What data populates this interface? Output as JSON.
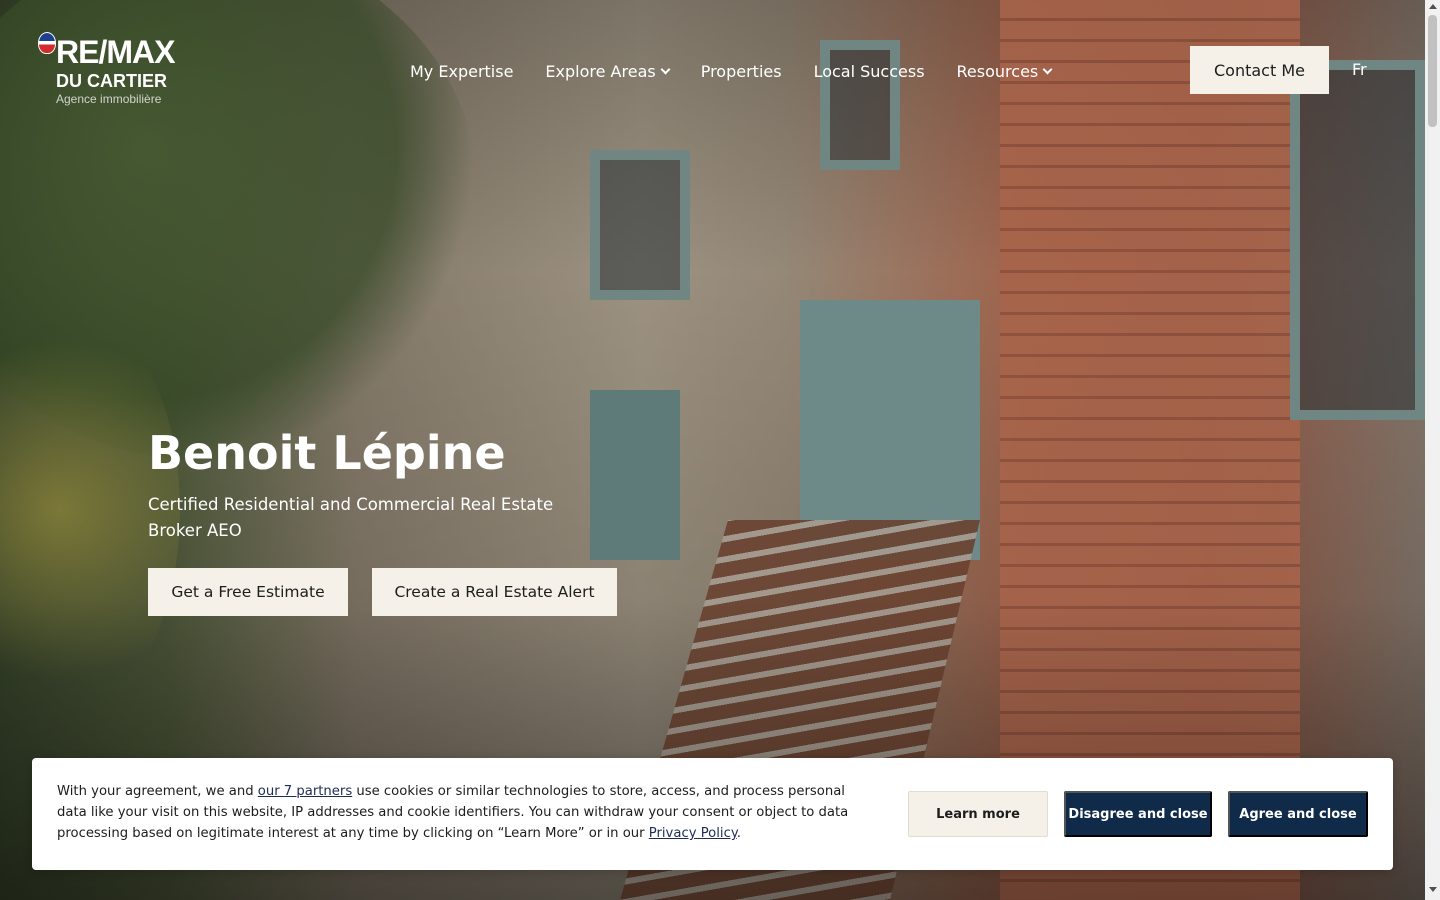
{
  "brand": {
    "name": "RE/MAX",
    "office": "DU CARTIER",
    "agency": "Agence immobilière"
  },
  "nav": {
    "items": [
      {
        "label": "My Expertise",
        "dropdown": false
      },
      {
        "label": "Explore Areas",
        "dropdown": true
      },
      {
        "label": "Properties",
        "dropdown": false
      },
      {
        "label": "Local Success",
        "dropdown": false
      },
      {
        "label": "Resources",
        "dropdown": true
      }
    ],
    "contact_label": "Contact Me",
    "language_label": "Fr"
  },
  "hero": {
    "name": "Benoit Lépine",
    "title": "Certified Residential and Commercial Real Estate Broker AEO",
    "cta_estimate": "Get a Free Estimate",
    "cta_alert": "Create a Real Estate Alert"
  },
  "cookie": {
    "text_before_link": "With your agreement, we and ",
    "partners_link": "our 7 partners",
    "text_middle": " use cookies or similar technologies to store, access, and process personal data like your visit on this website, IP addresses and cookie identifiers. You can withdraw your consent or object to data processing based on legitimate interest at any time by clicking on “Learn More” or in our ",
    "privacy_link": "Privacy Policy",
    "text_end": ".",
    "learn_more": "Learn more",
    "disagree": "Disagree and close",
    "agree": "Agree and close"
  },
  "colors": {
    "button_light": "#f5f1e9",
    "button_dark": "#102a4a",
    "link": "#1d2d55"
  }
}
